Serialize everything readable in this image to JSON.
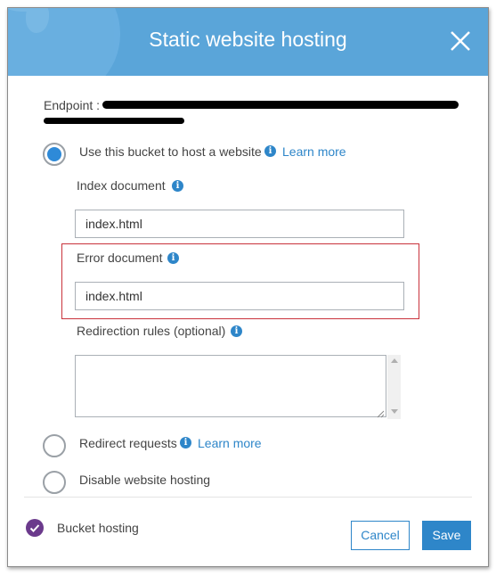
{
  "dialog": {
    "title": "Static website hosting",
    "endpoint_label": "Endpoint :"
  },
  "options": {
    "host": {
      "label": "Use this bucket to host a website",
      "link": "Learn more",
      "selected": true
    },
    "redirect": {
      "label": "Redirect requests",
      "link": "Learn more",
      "selected": false
    },
    "disable": {
      "label": "Disable website hosting",
      "selected": false
    }
  },
  "fields": {
    "index": {
      "label": "Index document",
      "value": "index.html"
    },
    "error": {
      "label": "Error document",
      "value": "index.html"
    },
    "redirection": {
      "label": "Redirection rules (optional)",
      "value": ""
    }
  },
  "footer": {
    "status_label": "Bucket hosting",
    "cancel_label": "Cancel",
    "save_label": "Save"
  },
  "colors": {
    "header": "#5aa5d9",
    "accent": "#2e86c9",
    "highlight_border": "#c9323b",
    "check_badge": "#6b3a8c"
  },
  "icons": [
    "close-icon",
    "info-icon",
    "checkmark-icon",
    "resize-grip-icon"
  ]
}
